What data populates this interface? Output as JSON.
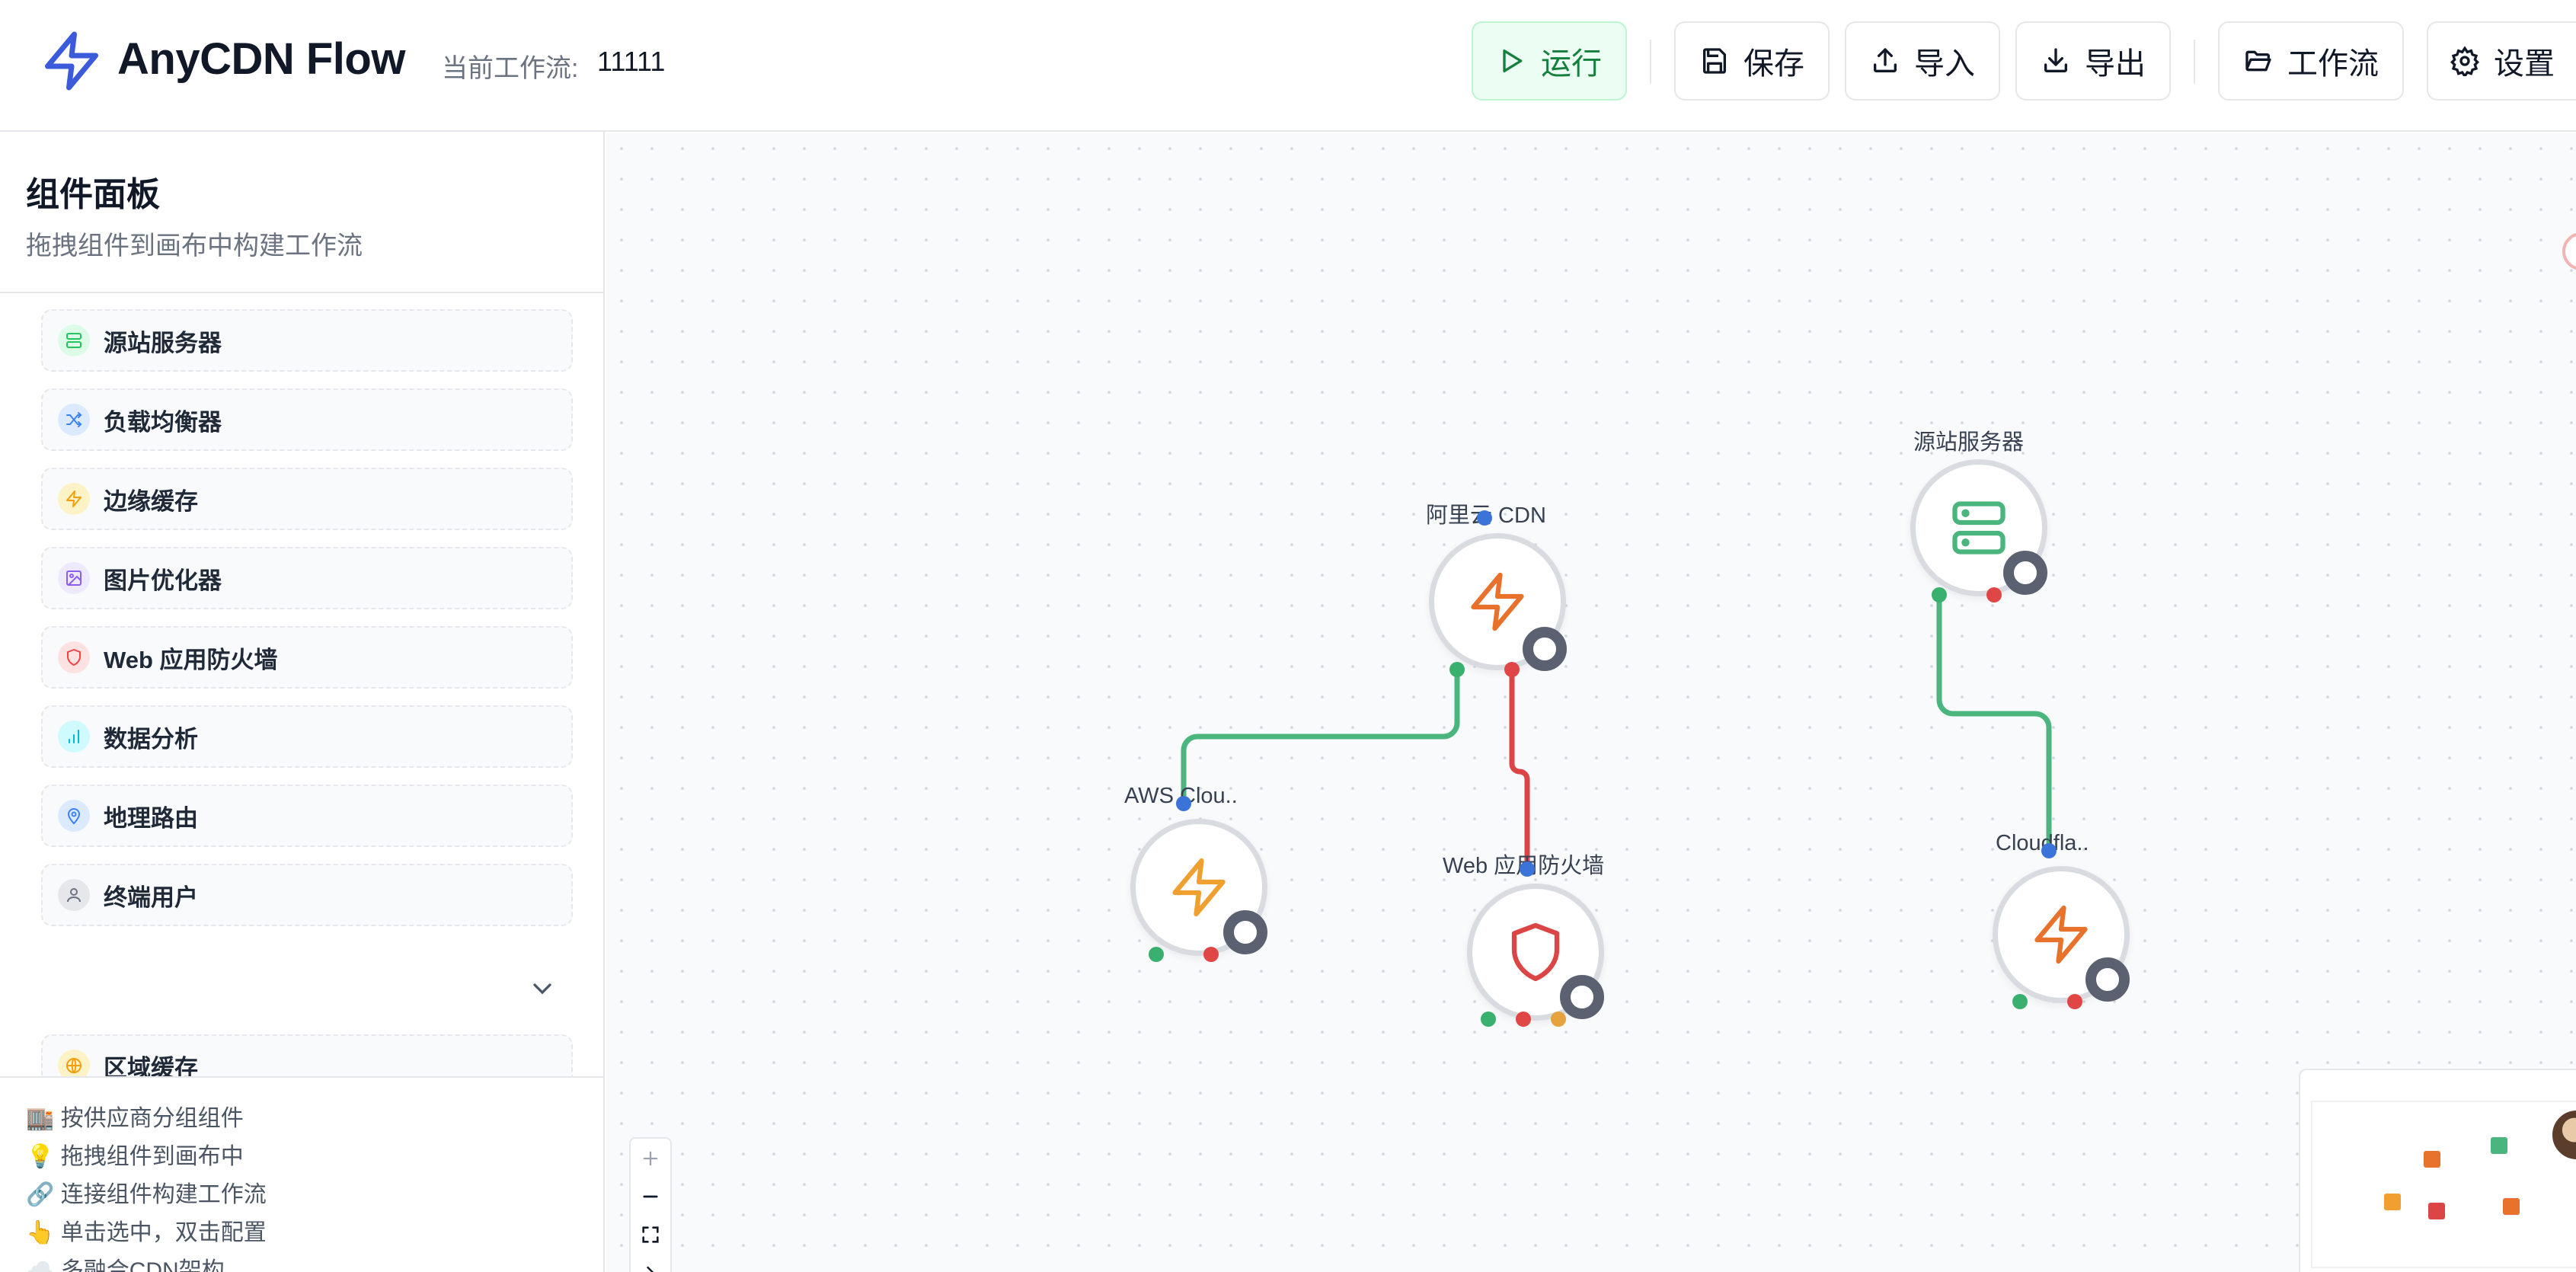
{
  "header": {
    "app_title": "AnyCDN Flow",
    "workflow_label": "当前工作流:",
    "workflow_name": "11111",
    "buttons": {
      "run": "运行",
      "save": "保存",
      "import": "导入",
      "export": "导出",
      "workflows": "工作流",
      "settings": "设置"
    }
  },
  "sidebar": {
    "title": "组件面板",
    "subtitle": "拖拽组件到画布中构建工作流",
    "components": [
      {
        "label": "源站服务器",
        "icon": "server-icon",
        "color": "#22c55e"
      },
      {
        "label": "负载均衡器",
        "icon": "shuffle-icon",
        "color": "#3b82f6"
      },
      {
        "label": "边缘缓存",
        "icon": "zap-icon",
        "color": "#f59e0b"
      },
      {
        "label": "图片优化器",
        "icon": "image-icon",
        "color": "#8b5cf6"
      },
      {
        "label": "Web 应用防火墙",
        "icon": "shield-icon",
        "color": "#ef4444"
      },
      {
        "label": "数据分析",
        "icon": "bar-chart-icon",
        "color": "#06b6d4"
      },
      {
        "label": "地理路由",
        "icon": "map-pin-icon",
        "color": "#3b82f6"
      },
      {
        "label": "终端用户",
        "icon": "user-icon",
        "color": "#6b7280"
      }
    ],
    "regional_cache": {
      "label": "区域缓存",
      "icon": "globe-icon",
      "color": "#f59e0b"
    },
    "tips": [
      "🏬 按供应商分组组件",
      "💡 拖拽组件到画布中",
      "🔗 连接组件构建工作流",
      "👆 单击选中，双击配置",
      "☁️ 多融合CDN架构"
    ]
  },
  "canvas": {
    "nodes": [
      {
        "label": "阿里云 CDN",
        "icon": "zap-icon"
      },
      {
        "label": "源站服务器",
        "icon": "server-icon"
      },
      {
        "label": "AWS Clou..",
        "icon": "zap-icon"
      },
      {
        "label": "Web 应用防火墙",
        "icon": "shield-icon"
      },
      {
        "label": "Cloudfla..",
        "icon": "zap-icon"
      }
    ],
    "colors": {
      "edge_green": "#4bb57e",
      "edge_red": "#dc4545",
      "handle_blue": "#3b74d8",
      "handle_green": "#3ab06e",
      "handle_red": "#e04646",
      "handle_orange": "#e6a23c"
    }
  }
}
